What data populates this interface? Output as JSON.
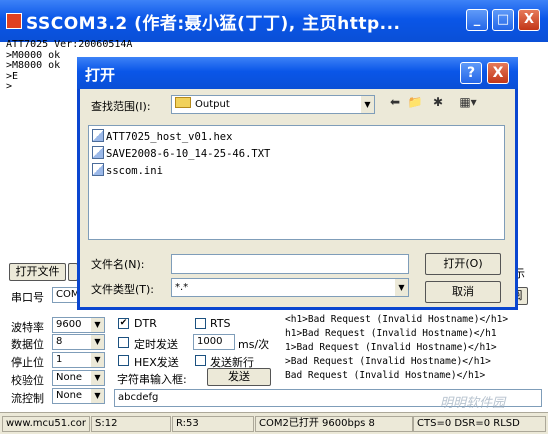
{
  "main_window": {
    "title": "SSCOM3.2 (作者:聂小猛(丁丁), 主页http...",
    "minimize": "_",
    "maximize": "□",
    "close": "X"
  },
  "log_lines": [
    "ATT7025 Ver:20060514A",
    ">M0000 ok",
    ">M8000 ok",
    ">E",
    ">"
  ],
  "controls": {
    "open_file_button": "打开文件",
    "port_label": "串口号",
    "port_value": "COM2",
    "show_label": "示",
    "close_port_partial": "阅",
    "baud_label": "波特率",
    "baud_value": "9600",
    "databits_label": "数据位",
    "databits_value": "8",
    "stopbits_label": "停止位",
    "stopbits_value": "1",
    "parity_label": "校验位",
    "parity_value": "None",
    "flow_label": "流控制",
    "flow_value": "None",
    "dtr_label": "DTR",
    "dtr_checked": "✔",
    "rts_label": "RTS",
    "timed_send_label": "定时发送",
    "interval_value": "1000",
    "interval_unit": "ms/次",
    "hex_send_label": "HEX发送",
    "send_newline_label": "发送新行",
    "string_input_label": "字符串输入框:",
    "send_button": "发送",
    "input_value": "abcdefg"
  },
  "response_lines": [
    "<h1>Bad Request (Invalid Hostname)</h1>",
    "h1>Bad Request (Invalid Hostname)</h1",
    "1>Bad Request (Invalid Hostname)</h1>",
    ">Bad Request (Invalid Hostname)</h1>",
    "Bad Request (Invalid Hostname)</h1>"
  ],
  "status_bar": {
    "website": "www.mcu51.cor",
    "s_count": "S:12",
    "r_count": "R:53",
    "port_status": "COM2已打开  9600bps  8",
    "signals": "CTS=0 DSR=0 RLSD"
  },
  "open_dialog": {
    "title": "打开",
    "help": "?",
    "close": "X",
    "look_in_label": "查找范围(I):",
    "look_in_value": "Output",
    "files": [
      "ATT7025_host_v01.hex",
      "SAVE2008-6-10_14-25-46.TXT",
      "sscom.ini"
    ],
    "filename_label": "文件名(N):",
    "filename_value": "",
    "filetype_label": "文件类型(T):",
    "filetype_value": "*.*",
    "open_button": "打开(O)",
    "cancel_button": "取消"
  },
  "watermark": "明明软件园"
}
